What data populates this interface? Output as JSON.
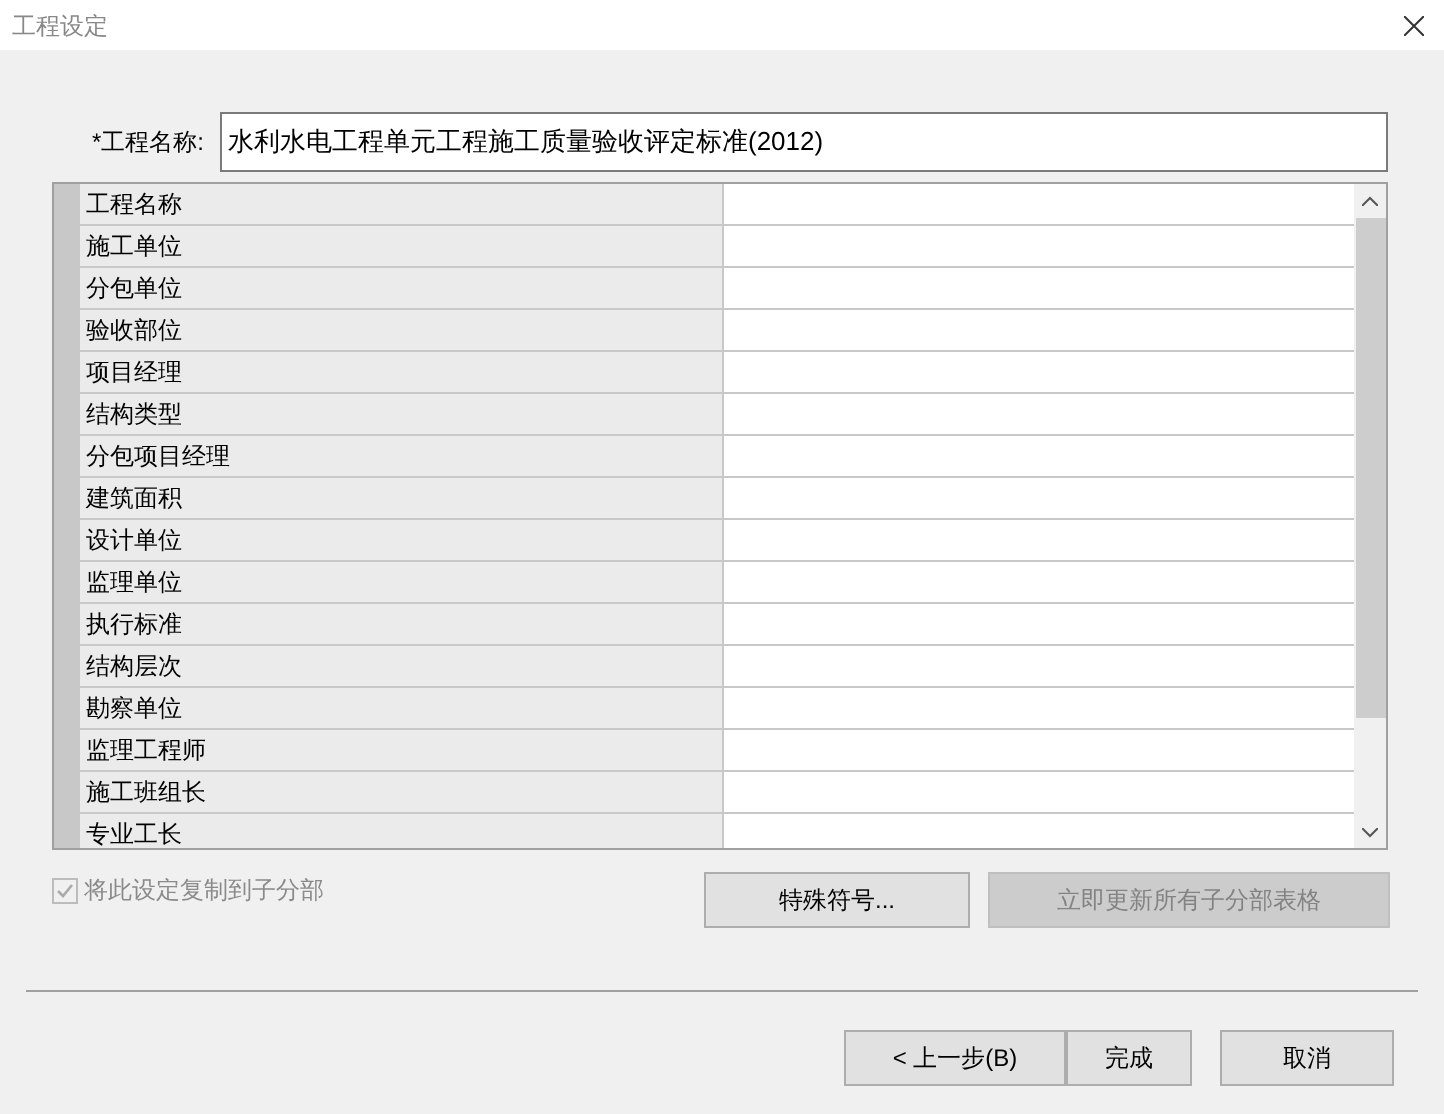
{
  "window": {
    "title": "工程设定"
  },
  "name_field": {
    "label": "*工程名称:",
    "value": "水利水电工程单元工程施工质量验收评定标准(2012)"
  },
  "properties": [
    {
      "label": "工程名称"
    },
    {
      "label": "施工单位"
    },
    {
      "label": "分包单位"
    },
    {
      "label": "验收部位"
    },
    {
      "label": "项目经理"
    },
    {
      "label": "结构类型"
    },
    {
      "label": "分包项目经理"
    },
    {
      "label": "建筑面积"
    },
    {
      "label": "设计单位"
    },
    {
      "label": "监理单位"
    },
    {
      "label": "执行标准"
    },
    {
      "label": "结构层次"
    },
    {
      "label": "勘察单位"
    },
    {
      "label": "监理工程师"
    },
    {
      "label": "施工班组长"
    },
    {
      "label": "专业工长"
    }
  ],
  "copy_checkbox": {
    "label": "将此设定复制到子分部",
    "checked": true,
    "disabled": true
  },
  "action_buttons": [
    {
      "label": "特殊符号...",
      "disabled": false
    },
    {
      "label": "立即更新所有子分部表格",
      "disabled": true
    }
  ],
  "footer_buttons": [
    {
      "label": "< 上一步(B)"
    },
    {
      "label": "完成"
    },
    {
      "label": "取消"
    }
  ]
}
